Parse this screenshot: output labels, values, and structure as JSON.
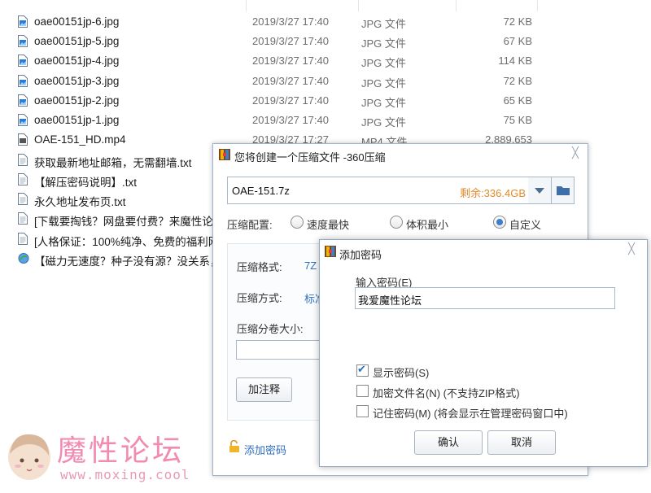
{
  "files": [
    {
      "name": "oae00151jp-6.jpg",
      "date": "2019/3/27 17:40",
      "type": "JPG 文件",
      "size": "72 KB",
      "icon": "jpg-image-icon"
    },
    {
      "name": "oae00151jp-5.jpg",
      "date": "2019/3/27 17:40",
      "type": "JPG 文件",
      "size": "67 KB",
      "icon": "jpg-image-icon"
    },
    {
      "name": "oae00151jp-4.jpg",
      "date": "2019/3/27 17:40",
      "type": "JPG 文件",
      "size": "114 KB",
      "icon": "jpg-image-icon"
    },
    {
      "name": "oae00151jp-3.jpg",
      "date": "2019/3/27 17:40",
      "type": "JPG 文件",
      "size": "72 KB",
      "icon": "jpg-image-icon"
    },
    {
      "name": "oae00151jp-2.jpg",
      "date": "2019/3/27 17:40",
      "type": "JPG 文件",
      "size": "65 KB",
      "icon": "jpg-image-icon"
    },
    {
      "name": "oae00151jp-1.jpg",
      "date": "2019/3/27 17:40",
      "type": "JPG 文件",
      "size": "75 KB",
      "icon": "jpg-image-icon"
    },
    {
      "name": "OAE-151_HD.mp4",
      "date": "2019/3/27 17:27",
      "type": "MP4 文件",
      "size": "2,889,653",
      "icon": "mp4-file-icon"
    },
    {
      "name": "获取最新地址邮箱，无需翻墙.txt",
      "date": "",
      "type": "",
      "size": "",
      "icon": "text-file-icon"
    },
    {
      "name": "【解压密码说明】.txt",
      "date": "",
      "type": "",
      "size": "",
      "icon": "text-file-icon"
    },
    {
      "name": "永久地址发布页.txt",
      "date": "",
      "type": "",
      "size": "",
      "icon": "text-file-icon"
    },
    {
      "name": "[下载要掏钱？网盘要付费？来魔性论",
      "date": "",
      "type": "",
      "size": "",
      "icon": "text-file-icon"
    },
    {
      "name": "[人格保证：100%纯净、免费的福利网",
      "date": "",
      "type": "",
      "size": "",
      "icon": "text-file-icon"
    },
    {
      "name": "【磁力无速度？种子没有源？没关系，",
      "date": "",
      "type": "",
      "size": "",
      "icon": "url-shortcut-icon"
    }
  ],
  "compress_dialog": {
    "title": "您将创建一个压缩文件 -360压缩",
    "path": "OAE-151.7z",
    "free_space": "剩余:336.4GB",
    "config_label": "压缩配置:",
    "options": [
      "速度最快",
      "体积最小",
      "自定义"
    ],
    "selected_option": "自定义",
    "format_label": "压缩格式:",
    "format_value": "7Z",
    "method_label": "压缩方式:",
    "method_value": "标准",
    "split_label": "压缩分卷大小:",
    "comment_button": "加注释",
    "add_password_link": "添加密码"
  },
  "password_dialog": {
    "title": "添加密码",
    "input_label": "输入密码(E)",
    "password_value": "我爱魔性论坛",
    "show_password": "显示密码(S)",
    "show_password_checked": true,
    "encrypt_filenames": "加密文件名(N) (不支持ZIP格式)",
    "encrypt_filenames_checked": false,
    "remember_password": "记住密码(M) (将会显示在管理密码窗口中)",
    "remember_password_checked": false,
    "ok_button": "确认",
    "cancel_button": "取消"
  },
  "watermark": {
    "title": "魔性论坛",
    "url": "www.moxing.cool"
  },
  "colors": {
    "accent": "#2f6fbf",
    "free_space": "#e28a2b",
    "watermark": "#f28bb2"
  }
}
